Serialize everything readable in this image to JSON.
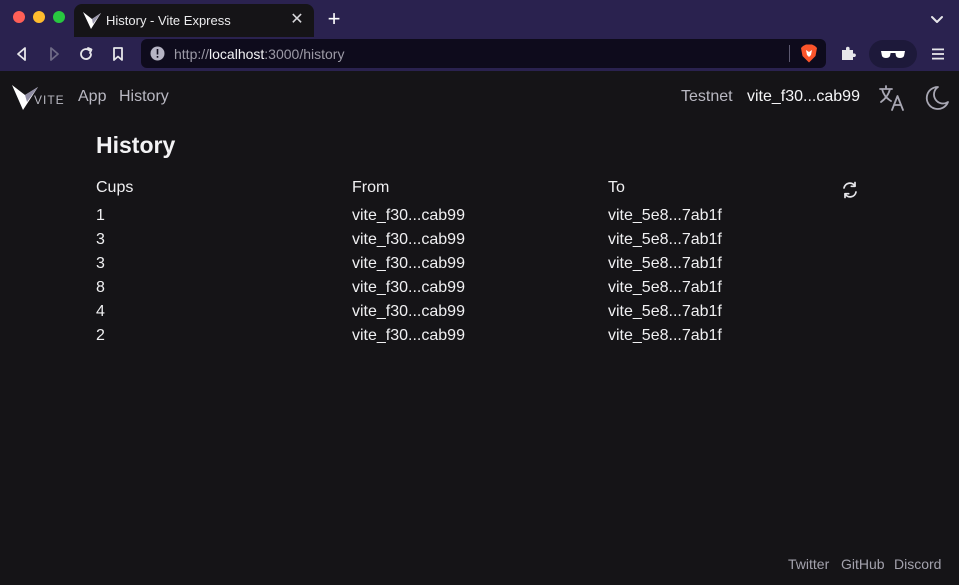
{
  "browser": {
    "tab_title": "History - Vite Express",
    "url_prefix": "http://",
    "url_host": "localhost",
    "url_rest": ":3000/history",
    "tab_close_glyph": "✕",
    "new_tab_glyph": "+"
  },
  "nav": {
    "logo_text": "VITE",
    "links": [
      "App",
      "History"
    ],
    "network": "Testnet",
    "wallet": "vite_f30...cab99"
  },
  "page": {
    "title": "History",
    "columns": [
      "Cups",
      "From",
      "To"
    ],
    "rows": [
      {
        "cups": "1",
        "from": "vite_f30...cab99",
        "to": "vite_5e8...7ab1f"
      },
      {
        "cups": "3",
        "from": "vite_f30...cab99",
        "to": "vite_5e8...7ab1f"
      },
      {
        "cups": "3",
        "from": "vite_f30...cab99",
        "to": "vite_5e8...7ab1f"
      },
      {
        "cups": "8",
        "from": "vite_f30...cab99",
        "to": "vite_5e8...7ab1f"
      },
      {
        "cups": "4",
        "from": "vite_f30...cab99",
        "to": "vite_5e8...7ab1f"
      },
      {
        "cups": "2",
        "from": "vite_f30...cab99",
        "to": "vite_5e8...7ab1f"
      }
    ]
  },
  "footer": {
    "links": [
      "Twitter",
      "GitHub",
      "Discord"
    ]
  },
  "icons": {
    "favicon": "vite-logo-icon",
    "back": "back-arrow-icon",
    "forward": "forward-arrow-icon",
    "reload": "reload-icon",
    "bookmark": "bookmark-icon",
    "site_info": "info-icon",
    "shields": "brave-shield-icon",
    "extensions": "puzzle-icon",
    "wallet_ext": "glasses-icon",
    "menu": "hamburger-menu-icon",
    "language": "translate-icon",
    "theme": "moon-icon",
    "refresh": "refresh-icon"
  },
  "colors": {
    "chrome_bg": "#2a224f",
    "page_bg": "#151417",
    "text": "#f0f0f2",
    "muted_text": "#b9b8c2",
    "brave_orange": "#fb542b"
  }
}
